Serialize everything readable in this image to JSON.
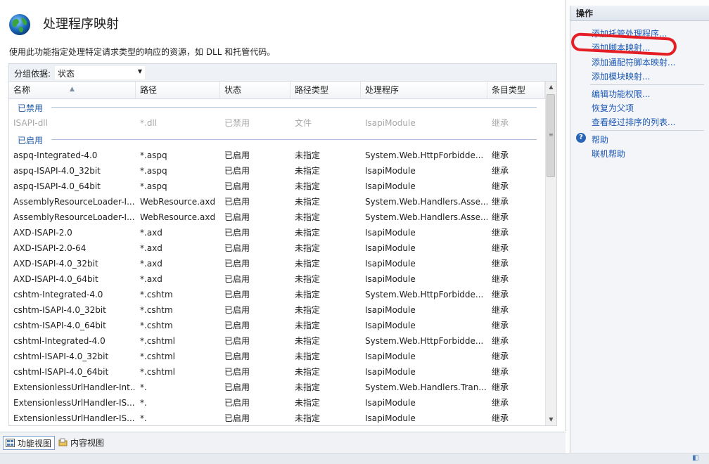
{
  "header": {
    "title": "处理程序映射",
    "description": "使用此功能指定处理特定请求类型的响应的资源，如 DLL 和托管代码。"
  },
  "groupBy": {
    "label": "分组依据:",
    "value": "状态"
  },
  "table": {
    "columns": [
      "名称",
      "路径",
      "状态",
      "路径类型",
      "处理程序",
      "条目类型"
    ],
    "groups": [
      {
        "label": "已禁用",
        "disabled": true,
        "rows": [
          [
            "ISAPI-dll",
            "*.dll",
            "已禁用",
            "文件",
            "IsapiModule",
            "继承"
          ]
        ]
      },
      {
        "label": "已启用",
        "disabled": false,
        "rows": [
          [
            "aspq-Integrated-4.0",
            "*.aspq",
            "已启用",
            "未指定",
            "System.Web.HttpForbidde...",
            "继承"
          ],
          [
            "aspq-ISAPI-4.0_32bit",
            "*.aspq",
            "已启用",
            "未指定",
            "IsapiModule",
            "继承"
          ],
          [
            "aspq-ISAPI-4.0_64bit",
            "*.aspq",
            "已启用",
            "未指定",
            "IsapiModule",
            "继承"
          ],
          [
            "AssemblyResourceLoader-I...",
            "WebResource.axd",
            "已启用",
            "未指定",
            "System.Web.Handlers.Asse...",
            "继承"
          ],
          [
            "AssemblyResourceLoader-I...",
            "WebResource.axd",
            "已启用",
            "未指定",
            "System.Web.Handlers.Asse...",
            "继承"
          ],
          [
            "AXD-ISAPI-2.0",
            "*.axd",
            "已启用",
            "未指定",
            "IsapiModule",
            "继承"
          ],
          [
            "AXD-ISAPI-2.0-64",
            "*.axd",
            "已启用",
            "未指定",
            "IsapiModule",
            "继承"
          ],
          [
            "AXD-ISAPI-4.0_32bit",
            "*.axd",
            "已启用",
            "未指定",
            "IsapiModule",
            "继承"
          ],
          [
            "AXD-ISAPI-4.0_64bit",
            "*.axd",
            "已启用",
            "未指定",
            "IsapiModule",
            "继承"
          ],
          [
            "cshtm-Integrated-4.0",
            "*.cshtm",
            "已启用",
            "未指定",
            "System.Web.HttpForbidde...",
            "继承"
          ],
          [
            "cshtm-ISAPI-4.0_32bit",
            "*.cshtm",
            "已启用",
            "未指定",
            "IsapiModule",
            "继承"
          ],
          [
            "cshtm-ISAPI-4.0_64bit",
            "*.cshtm",
            "已启用",
            "未指定",
            "IsapiModule",
            "继承"
          ],
          [
            "cshtml-Integrated-4.0",
            "*.cshtml",
            "已启用",
            "未指定",
            "System.Web.HttpForbidde...",
            "继承"
          ],
          [
            "cshtml-ISAPI-4.0_32bit",
            "*.cshtml",
            "已启用",
            "未指定",
            "IsapiModule",
            "继承"
          ],
          [
            "cshtml-ISAPI-4.0_64bit",
            "*.cshtml",
            "已启用",
            "未指定",
            "IsapiModule",
            "继承"
          ],
          [
            "ExtensionlessUrlHandler-Int...",
            "*.",
            "已启用",
            "未指定",
            "System.Web.Handlers.Tran...",
            "继承"
          ],
          [
            "ExtensionlessUrlHandler-IS...",
            "*.",
            "已启用",
            "未指定",
            "IsapiModule",
            "继承"
          ],
          [
            "ExtensionlessUrlHandler-IS...",
            "*.",
            "已启用",
            "未指定",
            "IsapiModule",
            "继承"
          ]
        ]
      }
    ]
  },
  "tabs": {
    "features": "功能视图",
    "content": "内容视图"
  },
  "actions": {
    "title": "操作",
    "add_managed_handler": "添加托管处理程序...",
    "add_script_map": "添加脚本映射...",
    "add_wildcard_script_map": "添加通配符脚本映射...",
    "add_module_mapping": "添加模块映射...",
    "edit_feature_permissions": "编辑功能权限...",
    "revert_to_parent": "恢复为父项",
    "view_ordered_list": "查看经过排序的列表...",
    "help": "帮助",
    "online_help": "联机帮助"
  },
  "colors": {
    "link": "#1d58b5",
    "group_text": "#1f5aa3",
    "annotation": "#e41e24"
  }
}
